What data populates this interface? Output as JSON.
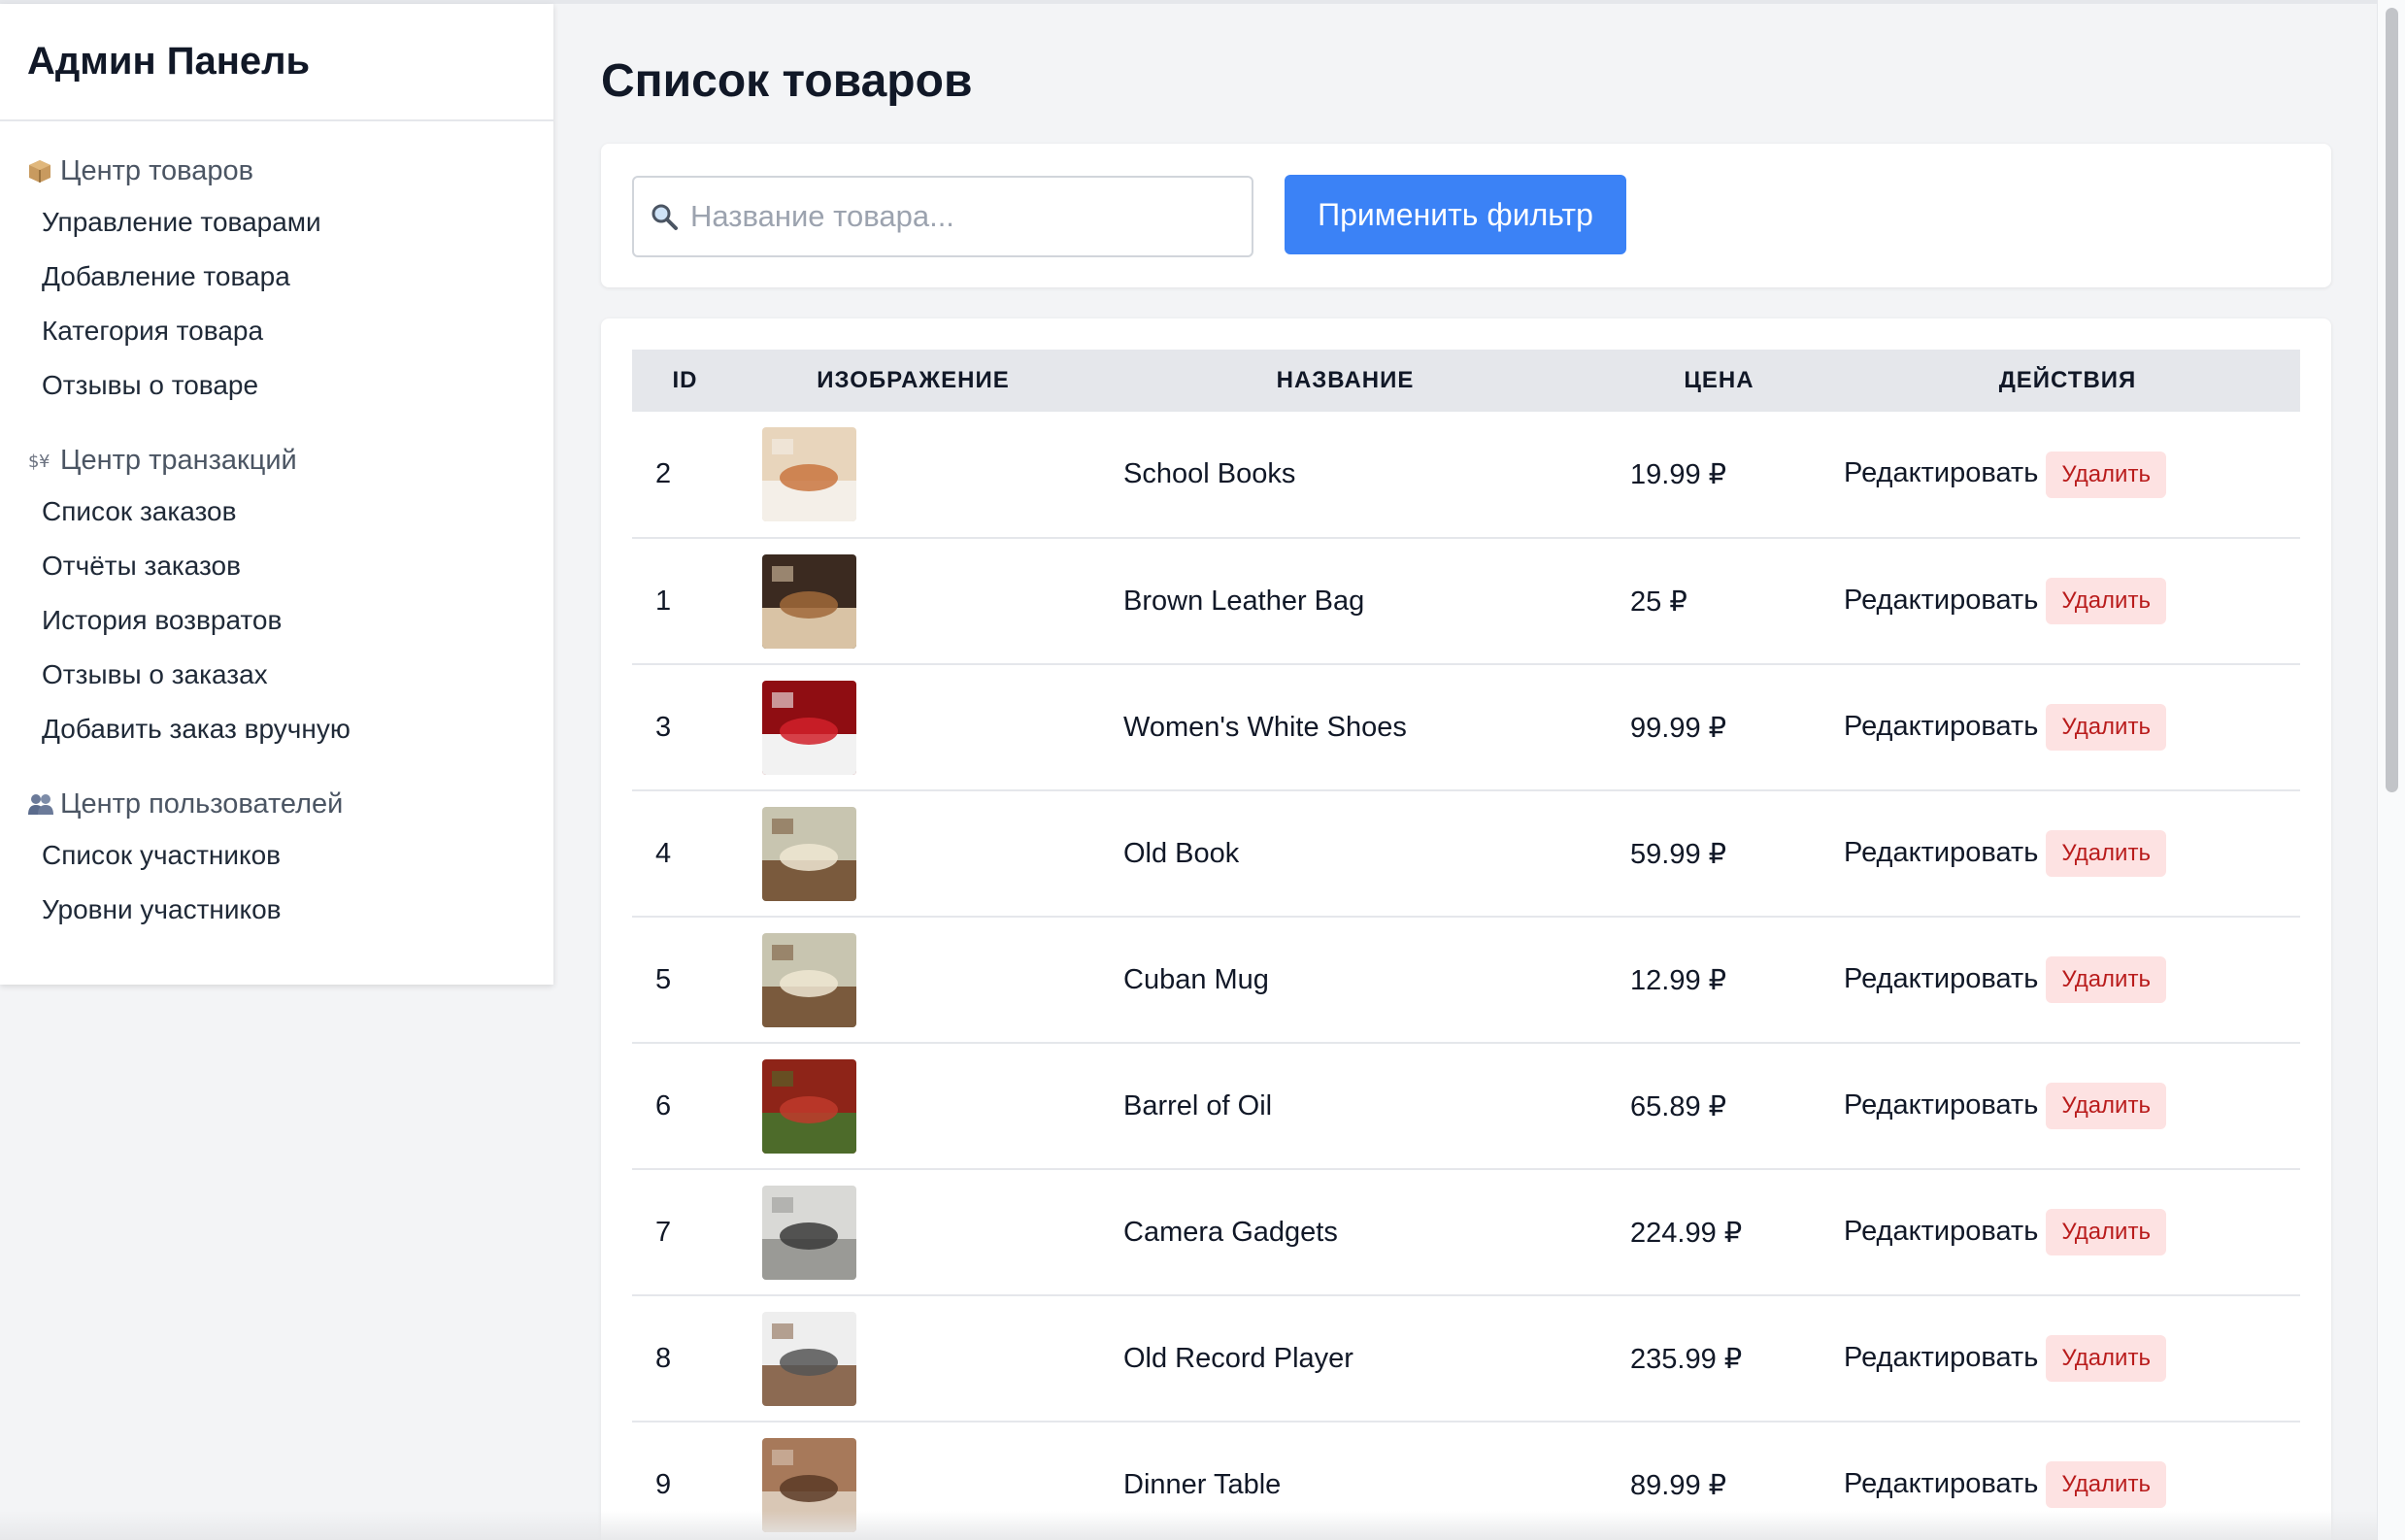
{
  "sidebar": {
    "title": "Админ Панель",
    "sections": [
      {
        "title": "Центр товаров",
        "icon": "package-icon",
        "items": [
          "Управление товарами",
          "Добавление товара",
          "Категория товара",
          "Отзывы о товаре"
        ]
      },
      {
        "title": "Центр транзакций",
        "icon": "transaction-icon",
        "items": [
          "Список заказов",
          "Отчёты заказов",
          "История возвратов",
          "Отзывы о заказах",
          "Добавить заказ вручную"
        ]
      },
      {
        "title": "Центр пользователей",
        "icon": "users-icon",
        "items": [
          "Список участников",
          "Уровни участников"
        ]
      }
    ]
  },
  "main": {
    "title": "Список товаров",
    "search": {
      "placeholder": "Название товара...",
      "value": ""
    },
    "apply_button": "Применить фильтр",
    "table": {
      "headers": [
        "ID",
        "ИЗОБРАЖЕНИЕ",
        "НАЗВАНИЕ",
        "ЦЕНА",
        "ДЕЙСТВИЯ"
      ],
      "edit_label": "Редактировать",
      "delete_label": "Удалить",
      "rows": [
        {
          "id": "2",
          "name": "School Books",
          "price": "19.99 ₽",
          "thumb_colors": [
            "#e8d5bc",
            "#c9753f",
            "#f4efe8"
          ]
        },
        {
          "id": "1",
          "name": "Brown Leather Bag",
          "price": "25 ₽",
          "thumb_colors": [
            "#3b2a20",
            "#a0683a",
            "#d9c3a5"
          ]
        },
        {
          "id": "3",
          "name": "Women's White Shoes",
          "price": "99.99 ₽",
          "thumb_colors": [
            "#8f0d12",
            "#d1212a",
            "#f2f2f2"
          ]
        },
        {
          "id": "4",
          "name": "Old Book",
          "price": "59.99 ₽",
          "thumb_colors": [
            "#c8c5b0",
            "#efe6d2",
            "#7a5a3d"
          ]
        },
        {
          "id": "5",
          "name": "Cuban Mug",
          "price": "12.99 ₽",
          "thumb_colors": [
            "#c8c5b0",
            "#efe6d2",
            "#7a5a3d"
          ]
        },
        {
          "id": "6",
          "name": "Barrel of Oil",
          "price": "65.89 ₽",
          "thumb_colors": [
            "#8e2418",
            "#c0392b",
            "#4d6b2a"
          ]
        },
        {
          "id": "7",
          "name": "Camera Gadgets",
          "price": "224.99 ₽",
          "thumb_colors": [
            "#d9d9d6",
            "#3a3a3a",
            "#9a9a96"
          ]
        },
        {
          "id": "8",
          "name": "Old Record Player",
          "price": "235.99 ₽",
          "thumb_colors": [
            "#eeeeee",
            "#555555",
            "#8c6a52"
          ]
        },
        {
          "id": "9",
          "name": "Dinner Table",
          "price": "89.99 ₽",
          "thumb_colors": [
            "#a7795a",
            "#5a3a26",
            "#d9c7b5"
          ]
        }
      ]
    }
  },
  "colors": {
    "accent": "#3b82f6",
    "delete_bg": "#fde2e2",
    "delete_text": "#b91c1c",
    "page_bg": "#f3f4f6"
  }
}
